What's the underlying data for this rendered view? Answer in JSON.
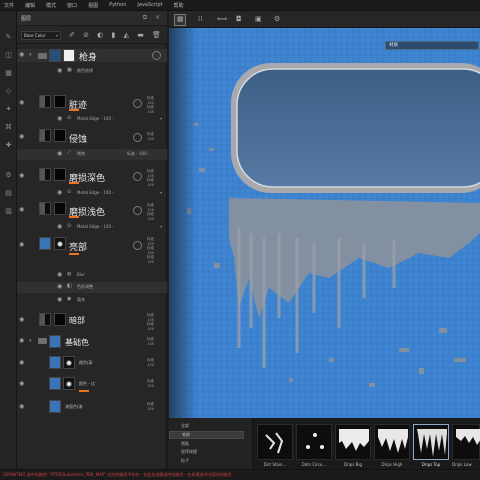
{
  "menubar": {
    "items": [
      "文件",
      "编辑",
      "模式",
      "窗口",
      "视图",
      "Python",
      "JavaScript",
      "帮助"
    ]
  },
  "layers_panel": {
    "title": "图层",
    "blend_mode": "Base Color",
    "layers": {
      "gun_body": {
        "name": "枪身",
        "sub": "颜色选择"
      },
      "dirt": {
        "name": "脏迹",
        "opacity": "100",
        "meta": "标准\n100\n标准\n100",
        "filter": "Metal Edge - 100 -"
      },
      "corrosion": {
        "name": "侵蚀",
        "opacity": "100",
        "meta": "标准\n100",
        "filter": "锈蚀",
        "filter_opacity": "标准 - 100 -"
      },
      "wear_dark": {
        "name": "磨损深色",
        "opacity": "100",
        "meta": "标准\n100\n标准\n100",
        "filter": "Metal Edge - 100 -"
      },
      "wear_light": {
        "name": "磨损浅色",
        "opacity": "100",
        "meta": "标准\n100\n标准\n100",
        "filter": "Metal Edge - 100 -"
      },
      "highlight": {
        "name": "亮部",
        "opacity": "100",
        "meta": "标准\n100\n标准\n100\n标准\n100",
        "subs": [
          "Blur",
          "色阶调整",
          "填充"
        ]
      },
      "dark_part": {
        "name": "暗部",
        "meta": "标准\n100\n标准\n100"
      },
      "base_color": {
        "name": "基础色",
        "meta": "标准\n100"
      },
      "fill_1": {
        "name": "颜色(高",
        "meta": "标准\n100"
      },
      "fill_2": {
        "name": "颜色 - 比",
        "meta": "标准\n100"
      },
      "fill_3": {
        "name": "漆面色(漆",
        "meta": "标准\n100"
      }
    }
  },
  "viewport": {
    "badge": "材质"
  },
  "shelf": {
    "categories": [
      "全部",
      "笔刷",
      "透贴",
      "程序纹理",
      "粒子"
    ],
    "selected_category": "笔刷",
    "brushes": [
      "Dirt Stain...",
      "Dots Circu...",
      "Drips Big",
      "Drips High",
      "Drips Top",
      "Drips Low"
    ],
    "selected_brush": "Drips Top"
  },
  "statusbar": {
    "text": "[SPAINTER] 选中的路径: \"RTRS\\Substance_PBR_MAP\" 对应的路径不存在 - 在此处创建选中的路径 - 在处理选中内容时的路径"
  },
  "colors": {
    "accent_orange": "#e9741c",
    "viewport_blue": "#3d82cf"
  }
}
